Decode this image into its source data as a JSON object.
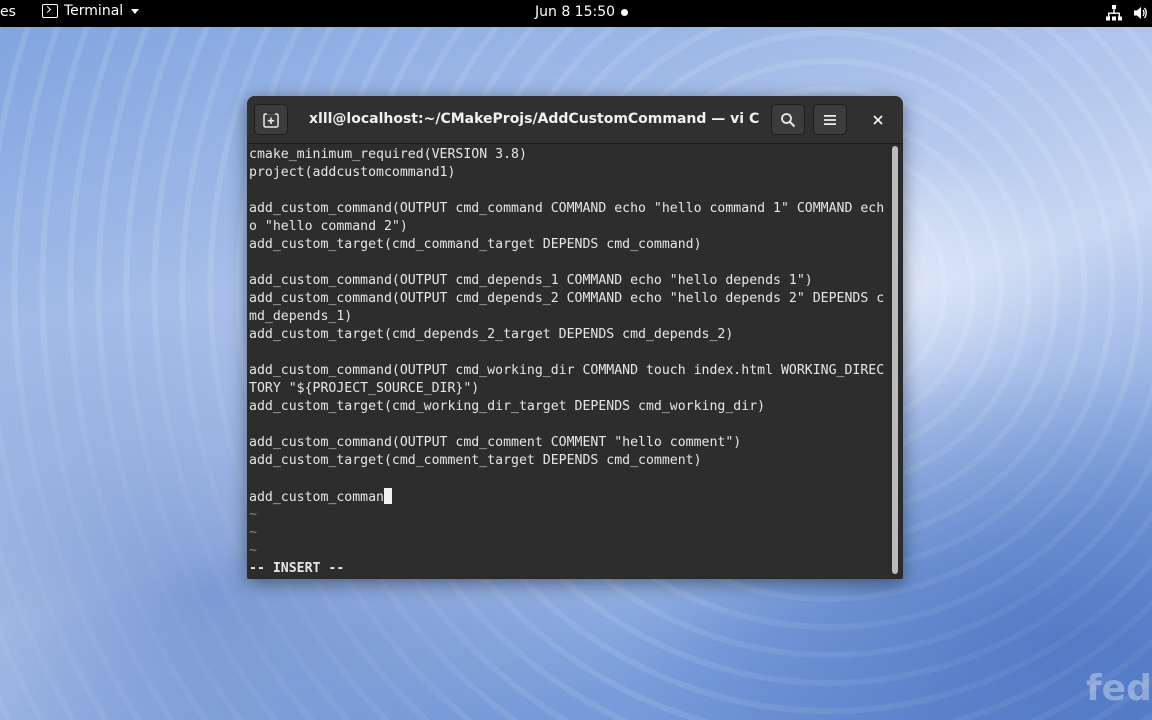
{
  "topbar": {
    "activities_label": "es",
    "app_name": "Terminal",
    "clock": "Jun 8  15:50"
  },
  "window": {
    "title": "xlll@localhost:~/CMakeProjs/AddCustomCommand — vi CMakeL…"
  },
  "terminal": {
    "lines": [
      "cmake_minimum_required(VERSION 3.8)",
      "project(addcustomcommand1)",
      "",
      "add_custom_command(OUTPUT cmd_command COMMAND echo \"hello command 1\" COMMAND ech",
      "o \"hello command 2\")",
      "add_custom_target(cmd_command_target DEPENDS cmd_command)",
      "",
      "add_custom_command(OUTPUT cmd_depends_1 COMMAND echo \"hello depends 1\")",
      "add_custom_command(OUTPUT cmd_depends_2 COMMAND echo \"hello depends 2\" DEPENDS c",
      "md_depends_1)",
      "add_custom_target(cmd_depends_2_target DEPENDS cmd_depends_2)",
      "",
      "add_custom_command(OUTPUT cmd_working_dir COMMAND touch index.html WORKING_DIREC",
      "TORY \"${PROJECT_SOURCE_DIR}\")",
      "add_custom_target(cmd_working_dir_target DEPENDS cmd_working_dir)",
      "",
      "add_custom_command(OUTPUT cmd_comment COMMENT \"hello comment\")",
      "add_custom_target(cmd_comment_target DEPENDS cmd_comment)",
      "",
      "add_custom_comman"
    ],
    "tildes": [
      "~",
      "~",
      "~"
    ],
    "status": "-- INSERT --"
  },
  "watermark": "fedo",
  "colors": {
    "topbar_bg": "#000000",
    "terminal_bg": "#2d2d2d",
    "terminal_fg": "#e6e6e6",
    "headerbar_bg": "#303030"
  },
  "icons": {
    "new_tab": "new-tab-icon",
    "search": "search-icon",
    "menu": "hamburger-menu-icon",
    "close": "close-icon",
    "network": "network-icon",
    "volume": "volume-icon"
  }
}
